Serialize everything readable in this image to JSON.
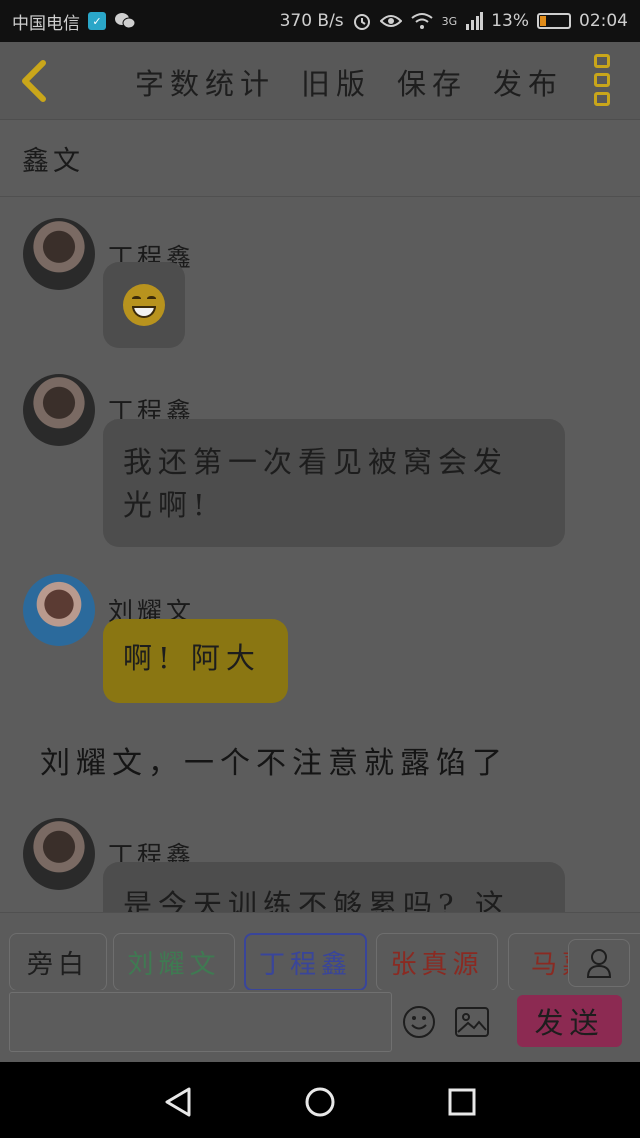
{
  "status_bar": {
    "carrier": "中国电信",
    "net_speed": "370 B/s",
    "network_type": "3G",
    "battery_percent": "13%",
    "time": "02:04"
  },
  "header": {
    "actions": [
      {
        "label": "字数统计"
      },
      {
        "label": "旧版"
      },
      {
        "label": "保存"
      },
      {
        "label": "发布"
      }
    ],
    "icons": {
      "back": "chevron-left-icon",
      "menu": "more-vertical-icon"
    },
    "accent_color": "#c9a61a"
  },
  "chat": {
    "title": "鑫文",
    "messages": [
      {
        "sender": "丁程鑫",
        "emoji": "grinning-face-icon"
      },
      {
        "sender": "丁程鑫",
        "text_line1": "我还第一次看见被窝会发",
        "text_line2": "光啊!"
      },
      {
        "sender": "刘耀文",
        "text": "啊! 阿大"
      },
      {
        "narration": "刘耀文，一个不注意就露馅了"
      },
      {
        "sender": "丁程鑫",
        "text": "是今天训练不够累吗? 这"
      }
    ]
  },
  "characters": {
    "chips": [
      {
        "label": "旁白",
        "color": "#1e1e1e"
      },
      {
        "label": "刘耀文",
        "color": "#3f7a52"
      },
      {
        "label": "丁程鑫",
        "color": "#39459a"
      },
      {
        "label": "张真源",
        "color": "#8a2a22"
      },
      {
        "label": "马嘉祺",
        "color": "#8a2a22"
      }
    ],
    "selected": "丁程鑫"
  },
  "input": {
    "value": "",
    "placeholder": "",
    "send_label": "发送",
    "send_color": "#8c2a52"
  }
}
